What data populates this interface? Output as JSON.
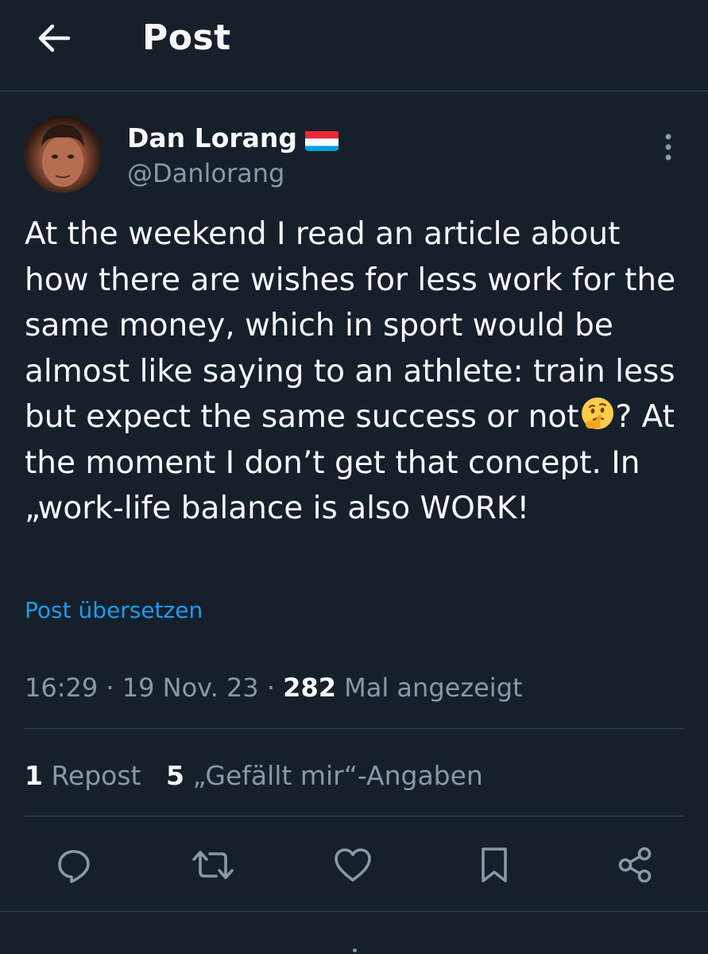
{
  "header": {
    "title": "Post"
  },
  "author": {
    "display_name": "Dan Lorang",
    "handle": "@Danlorang",
    "flag": "luxembourg-flag"
  },
  "post": {
    "text_part1": "At the weekend I read an article about how there are wishes for less work for the same money, which in sport would be almost like saying to an athlete: train less but expect the same success or not",
    "emoji": "thinking-face",
    "text_part2": "? At the moment I don’t get that concept. In „work-life balance is also WORK!",
    "translate_label": "Post übersetzen",
    "time": "16:29",
    "separator": "·",
    "date": "19 Nov. 23",
    "views_count": "282",
    "views_label": "Mal angezeigt"
  },
  "stats": {
    "reposts_count": "1",
    "reposts_label": "Repost",
    "likes_count": "5",
    "likes_label": "„Gefällt mir“-Angaben"
  },
  "actions": [
    "reply-icon",
    "repost-icon",
    "like-icon",
    "bookmark-icon",
    "share-icon"
  ],
  "colors": {
    "background": "#15202b",
    "text": "#f7f9f9",
    "secondary": "#8b98a5",
    "accent": "#1d9bf0",
    "divider": "#38444d"
  }
}
